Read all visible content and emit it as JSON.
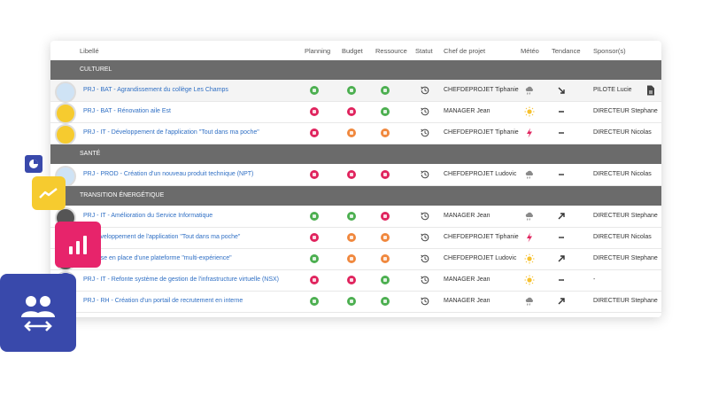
{
  "headers": {
    "libelle": "Libellé",
    "planning": "Planning",
    "budget": "Budget",
    "ressource": "Ressource",
    "statut": "Statut",
    "chef": "Chef de projet",
    "meteo": "Météo",
    "tendance": "Tendance",
    "sponsor": "Sponsor(s)"
  },
  "groups": [
    {
      "label": "CULTUREL"
    },
    {
      "label": "SANTÉ"
    },
    {
      "label": "TRANSITION ÉNERGÉTIQUE"
    }
  ],
  "rows": [
    {
      "project": "PRJ - BAT - Agrandissement du collège Les Champs",
      "planning": "green",
      "budget": "green",
      "ressource": "green",
      "chef": "CHEFDEPROJET Tiphanie",
      "meteo": "cloud-rain-icon",
      "tendance": "arrow-down-right-icon",
      "sponsor": "PILOTE Lucie",
      "doc": "document-icon"
    },
    {
      "project": "PRJ - BAT - Rénovation aile Est",
      "planning": "red",
      "budget": "red",
      "ressource": "green",
      "chef": "MANAGER Jean",
      "meteo": "sun-icon",
      "tendance": "dash-icon",
      "sponsor": "DIRECTEUR Stephane"
    },
    {
      "project": "PRJ - IT - Développement de l'application \"Tout dans ma poche\"",
      "planning": "red",
      "budget": "orange",
      "ressource": "orange",
      "chef": "CHEFDEPROJET Tiphanie",
      "meteo": "lightning-icon",
      "tendance": "dash-icon",
      "sponsor": "DIRECTEUR Nicolas"
    },
    {
      "project": "PRJ - PROD - Création d'un nouveau produit technique (NPT)",
      "planning": "red",
      "budget": "red",
      "ressource": "red",
      "chef": "CHEFDEPROJET Ludovic",
      "meteo": "cloud-rain-icon",
      "tendance": "dash-icon",
      "sponsor": "DIRECTEUR Nicolas"
    },
    {
      "project": "PRJ - IT - Amélioration du Service Informatique",
      "planning": "green",
      "budget": "green",
      "ressource": "red",
      "chef": "MANAGER Jean",
      "meteo": "cloud-rain-icon",
      "tendance": "arrow-up-right-icon",
      "sponsor": "DIRECTEUR Stephane"
    },
    {
      "project": "T - Développement de l'application \"Tout dans ma poche\"",
      "planning": "red",
      "budget": "orange",
      "ressource": "orange",
      "chef": "CHEFDEPROJET Tiphanie",
      "meteo": "lightning-icon",
      "tendance": "dash-icon",
      "sponsor": "DIRECTEUR Nicolas"
    },
    {
      "project": "IT - Mise en place d'une plateforme \"multi-expérience\"",
      "planning": "green",
      "budget": "orange",
      "ressource": "orange",
      "chef": "CHEFDEPROJET Ludovic",
      "meteo": "sun-icon",
      "tendance": "arrow-up-right-icon",
      "sponsor": "DIRECTEUR Stephane"
    },
    {
      "project": "PRJ - IT - Refonte système de gestion de l'infrastructure virtuelle (NSX)",
      "planning": "red",
      "budget": "red",
      "ressource": "green",
      "chef": "MANAGER Jean",
      "meteo": "sun-icon",
      "tendance": "dash-icon",
      "sponsor": "-"
    },
    {
      "project": "PRJ - RH - Création d'un portail de recrutement en interne",
      "planning": "green",
      "budget": "green",
      "ressource": "green",
      "chef": "MANAGER Jean",
      "meteo": "cloud-rain-icon",
      "tendance": "arrow-up-right-icon",
      "sponsor": "DIRECTEUR Stephane"
    }
  ],
  "colors": {
    "green": "#4caf50",
    "red": "#e0245e",
    "orange": "#f0883e",
    "link": "#2f6fc4",
    "group_bg": "#6b6b6b",
    "tile_blue": "#3949ab",
    "tile_yellow": "#f6cb2f",
    "tile_pink": "#e7246b"
  },
  "floating_icons": [
    "pie-chart-icon",
    "trend-line-icon",
    "bar-chart-icon",
    "users-swap-icon"
  ]
}
